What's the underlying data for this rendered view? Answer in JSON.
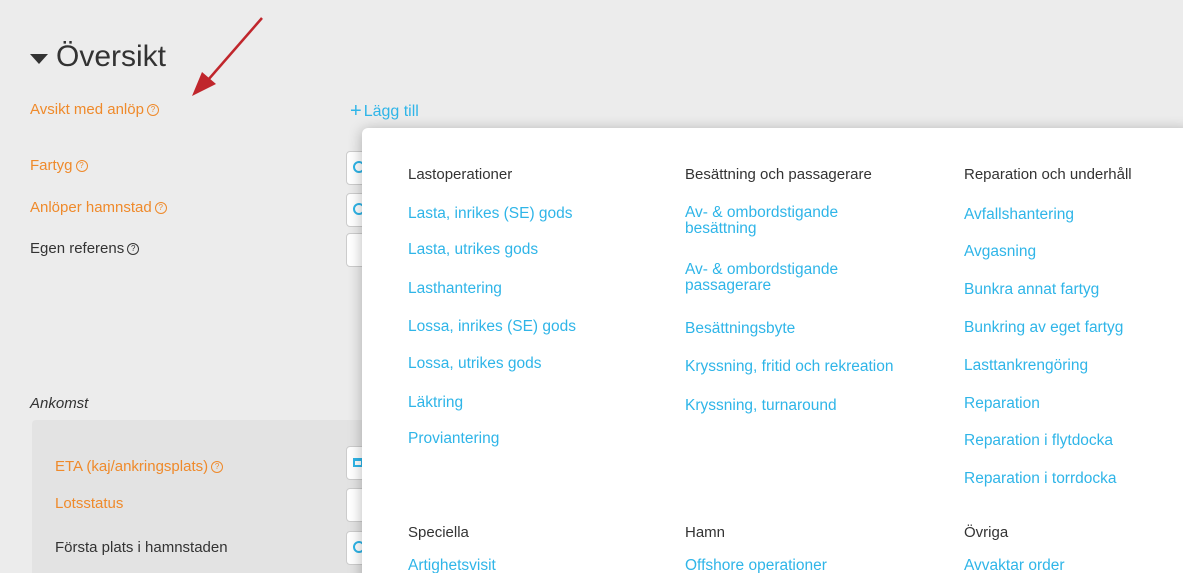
{
  "section": {
    "title": "Översikt"
  },
  "fields": {
    "avsikt": "Avsikt med anlöp",
    "fartyg": "Fartyg",
    "anloper": "Anlöper hamnstad",
    "egen_ref": "Egen referens",
    "ankomst": "Ankomst",
    "eta": "ETA (kaj/ankringsplats)",
    "lotsstatus": "Lotsstatus",
    "forsta_plats": "Första plats i hamnstaden"
  },
  "help_glyph": "?",
  "add": {
    "plus": "+",
    "label": "Lägg till"
  },
  "dropdown": {
    "groups": [
      {
        "header": "Lastoperationer",
        "items": [
          "Lasta, inrikes (SE) gods",
          "Lasta, utrikes gods",
          "Lasthantering",
          "Lossa, inrikes (SE) gods",
          "Lossa, utrikes gods",
          "Läktring",
          "Proviantering"
        ]
      },
      {
        "header": "Besättning och passagerare",
        "items": [
          "Av- & ombordstigande\nbesättning",
          "Av- & ombordstigande\npassagerare",
          "Besättningsbyte",
          "Kryssning, fritid och rekreation",
          "Kryssning, turnaround"
        ]
      },
      {
        "header": "Reparation och underhåll",
        "items": [
          "Avfallshantering",
          "Avgasning",
          "Bunkra annat fartyg",
          "Bunkring av eget fartyg",
          "Lasttankrengöring",
          "Reparation",
          "Reparation i flytdocka",
          "Reparation i torrdocka"
        ]
      },
      {
        "header": "Speciella",
        "items": [
          "Artighetsvisit"
        ]
      },
      {
        "header": "Hamn",
        "items": [
          "Offshore operationer"
        ]
      },
      {
        "header": "Övriga",
        "items": [
          "Avvaktar order"
        ]
      }
    ]
  },
  "colors": {
    "accent": "#2fb5e8",
    "label_orange": "#ef8a2b",
    "arrow": "#c0262c"
  }
}
